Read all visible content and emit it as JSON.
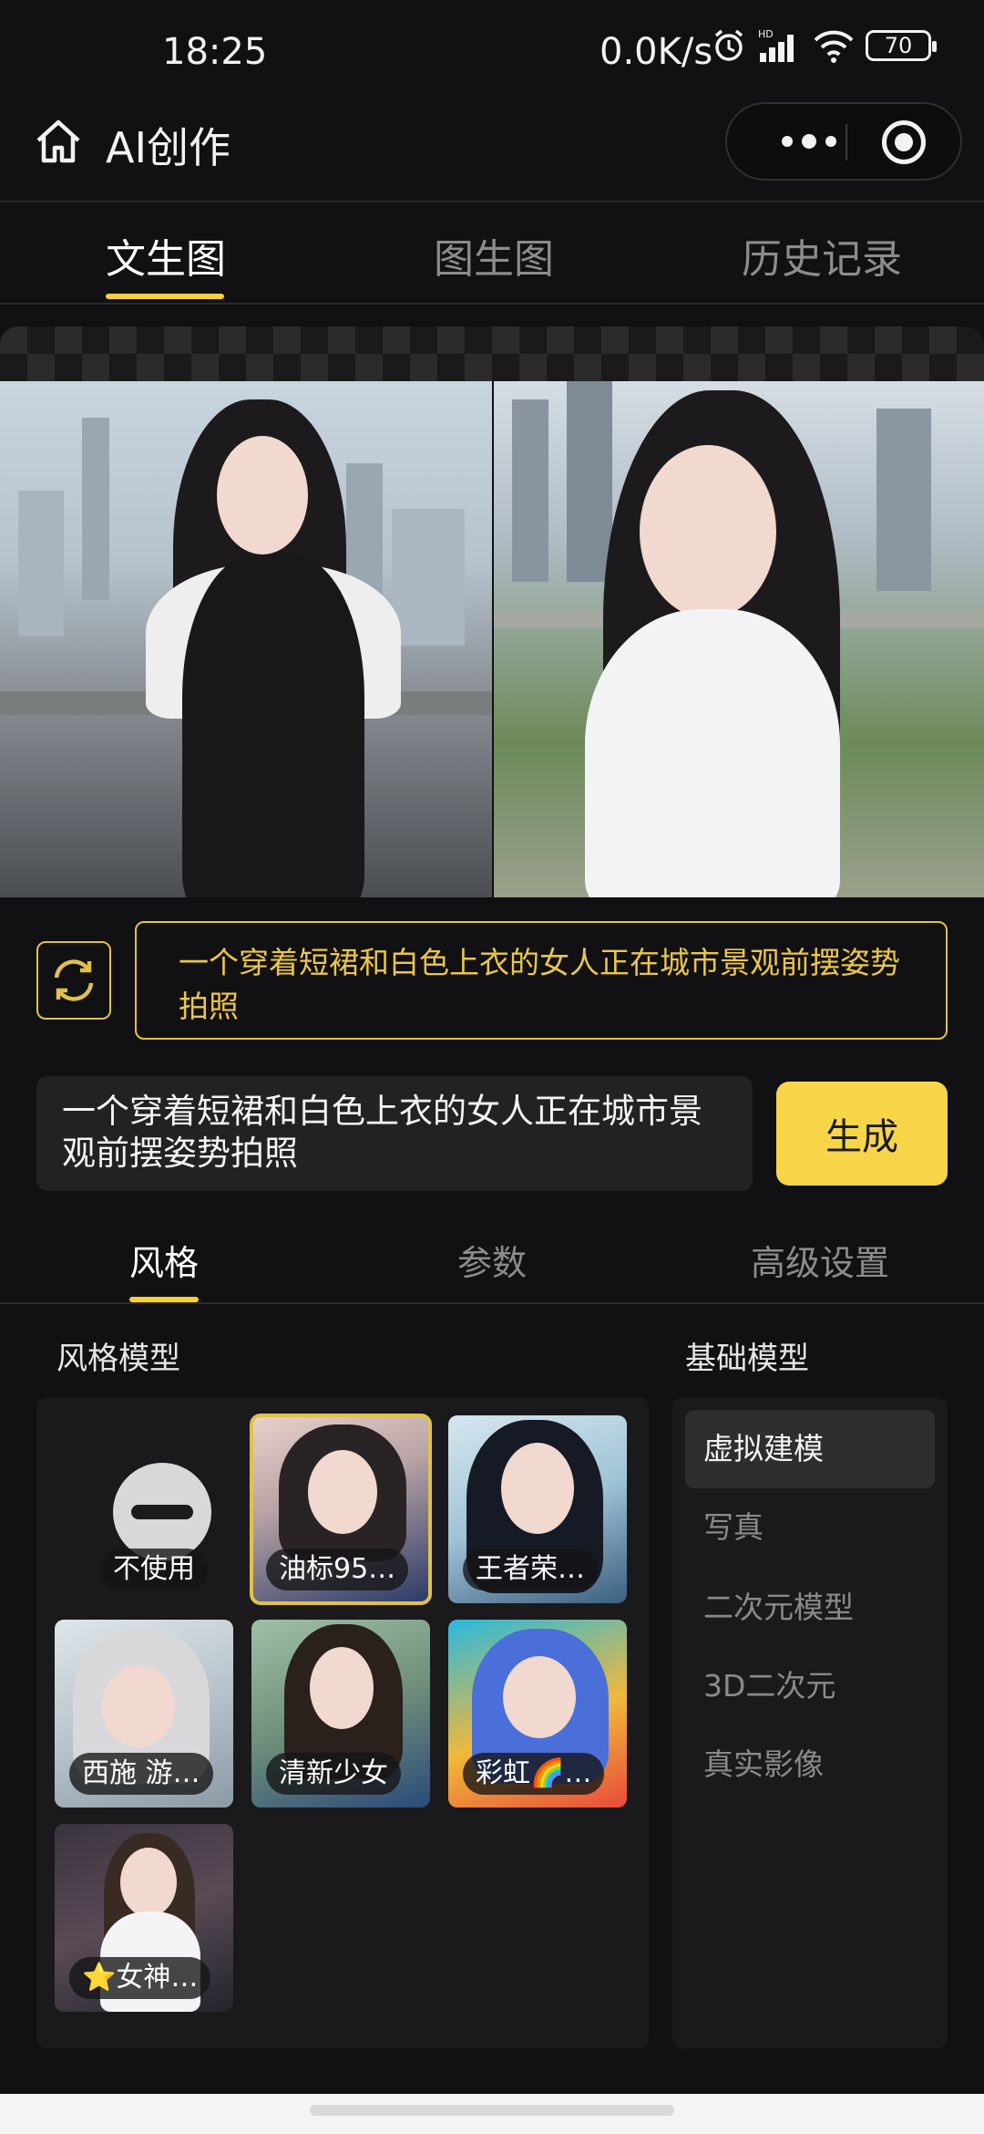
{
  "status_bar": {
    "time": "18:25",
    "net_speed": "0.0K/s",
    "battery": "70"
  },
  "nav": {
    "title": "AI创作"
  },
  "tabs": [
    {
      "label": "文生图",
      "active": true
    },
    {
      "label": "图生图",
      "active": false
    },
    {
      "label": "历史记录",
      "active": false
    }
  ],
  "suggestion": {
    "text": "一个穿着短裙和白色上衣的女人正在城市景观前摆姿势拍照"
  },
  "prompt": {
    "value": "一个穿着短裙和白色上衣的女人正在城市景观前摆姿势拍照"
  },
  "generate_label": "生成",
  "sub_tabs": [
    {
      "label": "风格",
      "active": true
    },
    {
      "label": "参数",
      "active": false
    },
    {
      "label": "高级设置",
      "active": false
    }
  ],
  "style_section_label": "风格模型",
  "base_section_label": "基础模型",
  "styles": [
    {
      "label": "不使用"
    },
    {
      "label": "油标95…"
    },
    {
      "label": "王者荣…"
    },
    {
      "label": "西施 游…"
    },
    {
      "label": "清新少女"
    },
    {
      "label": "彩虹🌈…"
    },
    {
      "label": "⭐女神…"
    }
  ],
  "base_models": [
    {
      "label": "虚拟建模",
      "active": true
    },
    {
      "label": "写真",
      "active": false
    },
    {
      "label": "二次元模型",
      "active": false
    },
    {
      "label": "3D二次元",
      "active": false
    },
    {
      "label": "真实影像",
      "active": false
    }
  ],
  "colors": {
    "accent": "#f7d549",
    "background": "#111113",
    "panel": "#1a1a1c"
  }
}
